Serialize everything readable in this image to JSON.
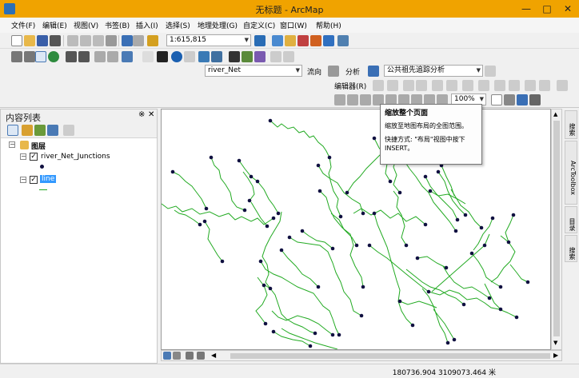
{
  "window": {
    "title": "无标题 - ArcMap"
  },
  "menu": [
    "文件(F)",
    "编辑(E)",
    "视图(V)",
    "书签(B)",
    "插入(I)",
    "选择(S)",
    "地理处理(G)",
    "自定义(C)",
    "窗口(W)",
    "帮助(H)"
  ],
  "toolbar": {
    "scale": "1:615,815",
    "layer_select": "river_Net",
    "flow_label": "流向",
    "analysis_label": "分析",
    "trace_task": "公共祖先追踪分析",
    "editor_label": "编辑器(R)",
    "zoom_percent": "100%"
  },
  "toc": {
    "title": "内容列表",
    "root_label": "图层",
    "layers": [
      {
        "label": "river_Net_Junctions",
        "checked": true
      },
      {
        "label": "line",
        "checked": true,
        "selected": true
      }
    ]
  },
  "tooltip": {
    "title": "缩放整个页面",
    "description": "缩放至地图布局的全图范围。",
    "shortcut": "快捷方式: \"布局\"视图中按下 INSERT。"
  },
  "right_dock": [
    "搜索",
    "ArcToolbox",
    "目录",
    "搜索"
  ],
  "status": {
    "coordinates": "180736.904  3109073.464 米"
  },
  "colors": {
    "title_bar": "#f0a300",
    "river": "#22aa22",
    "junction": "#101040"
  }
}
